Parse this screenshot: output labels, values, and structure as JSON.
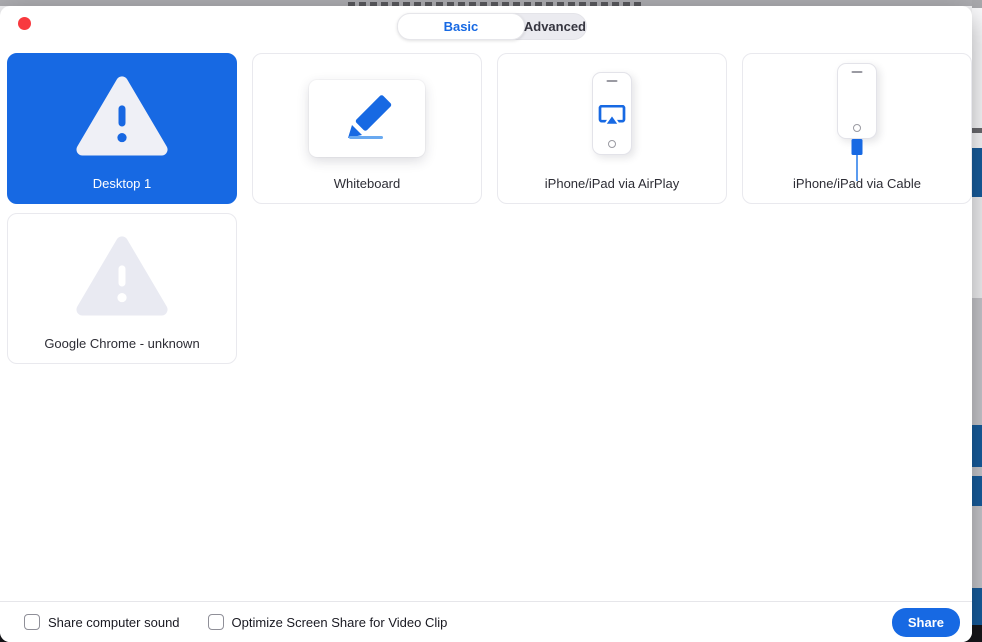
{
  "colors": {
    "accent": "#1769e3",
    "selected_tile": "#1767e2",
    "strip_blue": "#175d9e",
    "close_button_red": "#f8393e",
    "desktop_background_dark": "#17171b"
  },
  "window": {
    "tabs": [
      {
        "label": "Basic",
        "selected": true
      },
      {
        "label": "Advanced",
        "selected": false
      }
    ],
    "tiles": [
      {
        "label": "Desktop 1",
        "icon": "warning-triangle-icon",
        "selected": true
      },
      {
        "label": "Whiteboard",
        "icon": "pencil-icon",
        "selected": false
      },
      {
        "label": "iPhone/iPad via AirPlay",
        "icon": "phone-airplay-icon",
        "selected": false
      },
      {
        "label": "iPhone/iPad via Cable",
        "icon": "phone-cable-icon",
        "selected": false
      },
      {
        "label": "Google Chrome - unknown",
        "icon": "warning-triangle-icon",
        "selected": false
      }
    ],
    "footer": {
      "checkboxes": [
        {
          "label": "Share computer sound",
          "checked": false
        },
        {
          "label": "Optimize Screen Share for Video Clip",
          "checked": false
        }
      ],
      "share_label": "Share"
    }
  }
}
